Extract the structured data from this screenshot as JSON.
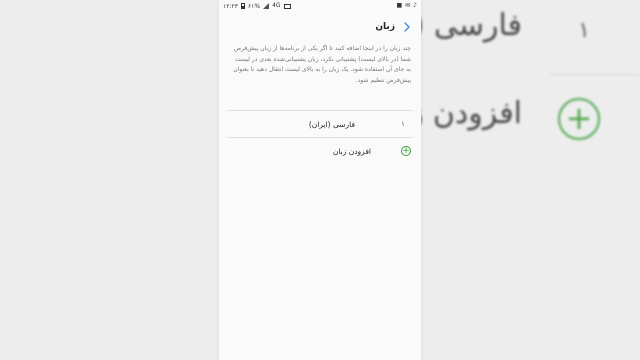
{
  "status_bar": {
    "time": "۱۲:۲۳",
    "battery_percent": "۶۱%",
    "network": "4G"
  },
  "header": {
    "title": "زبان"
  },
  "description": "چند زبان را در اینجا اضافه کنید تا اگر یکی از برنامه‌ها از زبان پیش‌فرض شما (در بالای لیست) پشتیبانی نکرد، زبان پشتیبانی‌شده بعدی در لیست به جای آن استفاده شود. یک زبان را به بالای لیست انتقال دهید تا بعنوان پیش‌فرض تنظیم شود.",
  "languages": [
    {
      "index": "۱",
      "label": "فارسی (ایران)"
    }
  ],
  "add_language": {
    "label": "افزودن زبان"
  },
  "background_zoom": {
    "index": "۱",
    "lang_text": "فارسی (ا",
    "add_text": "افزودن زبا"
  },
  "colors": {
    "accent_green": "#3b9f3b",
    "back_arrow": "#3b8fd9"
  }
}
